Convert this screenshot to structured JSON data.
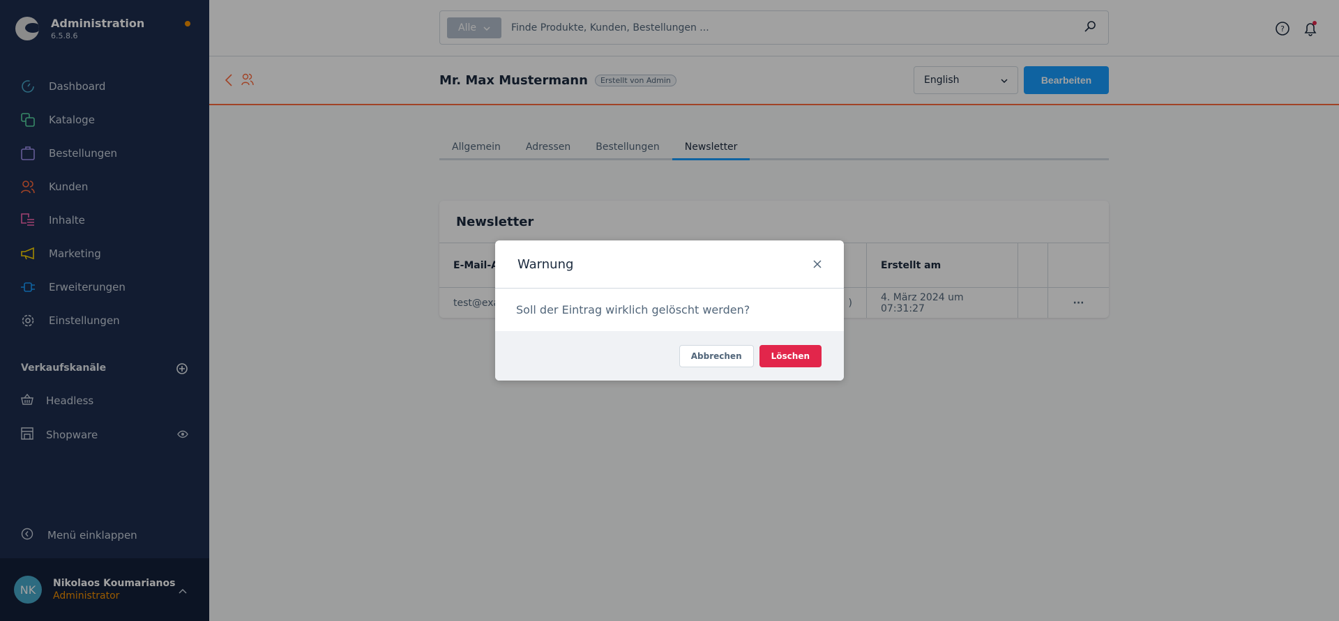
{
  "app": {
    "title": "Administration",
    "version": "6.5.8.6"
  },
  "sidebar": {
    "items": [
      {
        "label": "Dashboard",
        "icon": "gauge-icon",
        "color": "#48aacb"
      },
      {
        "label": "Kataloge",
        "icon": "catalog-icon",
        "color": "#57d9a3"
      },
      {
        "label": "Bestellungen",
        "icon": "bag-icon",
        "color": "#a092f0"
      },
      {
        "label": "Kunden",
        "icon": "users-icon",
        "color": "#ff6b3d"
      },
      {
        "label": "Inhalte",
        "icon": "content-icon",
        "color": "#ff68b4"
      },
      {
        "label": "Marketing",
        "icon": "megaphone-icon",
        "color": "#ffd700"
      },
      {
        "label": "Erweiterungen",
        "icon": "plug-icon",
        "color": "#189eff"
      },
      {
        "label": "Einstellungen",
        "icon": "gear-icon",
        "color": "#c9d2dd"
      }
    ],
    "sales_channels_title": "Verkaufskanäle",
    "sales_channels": [
      {
        "label": "Headless"
      },
      {
        "label": "Shopware"
      }
    ],
    "collapse_label": "Menü einklappen",
    "user": {
      "initials": "NK",
      "name": "Nikolaos Koumarianos",
      "role": "Administrator"
    }
  },
  "search": {
    "filter": "Alle",
    "placeholder": "Finde Produkte, Kunden, Bestellungen ..."
  },
  "header": {
    "title": "Mr. Max Mustermann",
    "badge": "Erstellt von Admin",
    "language": "English",
    "edit_label": "Bearbeiten"
  },
  "tabs": [
    {
      "label": "Allgemein"
    },
    {
      "label": "Adressen"
    },
    {
      "label": "Bestellungen"
    },
    {
      "label": "Newsletter",
      "active": true
    }
  ],
  "card": {
    "title": "Newsletter",
    "columns": [
      "E-Mail-A",
      "",
      "Erstellt am",
      "",
      ""
    ],
    "rows": [
      [
        "test@exa",
        ")",
        "4. März 2024 um 07:31:27",
        "",
        "···"
      ]
    ]
  },
  "modal": {
    "title": "Warnung",
    "message": "Soll der Eintrag wirklich gelöscht werden?",
    "cancel_label": "Abbrechen",
    "delete_label": "Löschen"
  },
  "colors": {
    "accent": "#189eff",
    "danger": "#e2264b",
    "header_line": "#ff6b3d"
  }
}
